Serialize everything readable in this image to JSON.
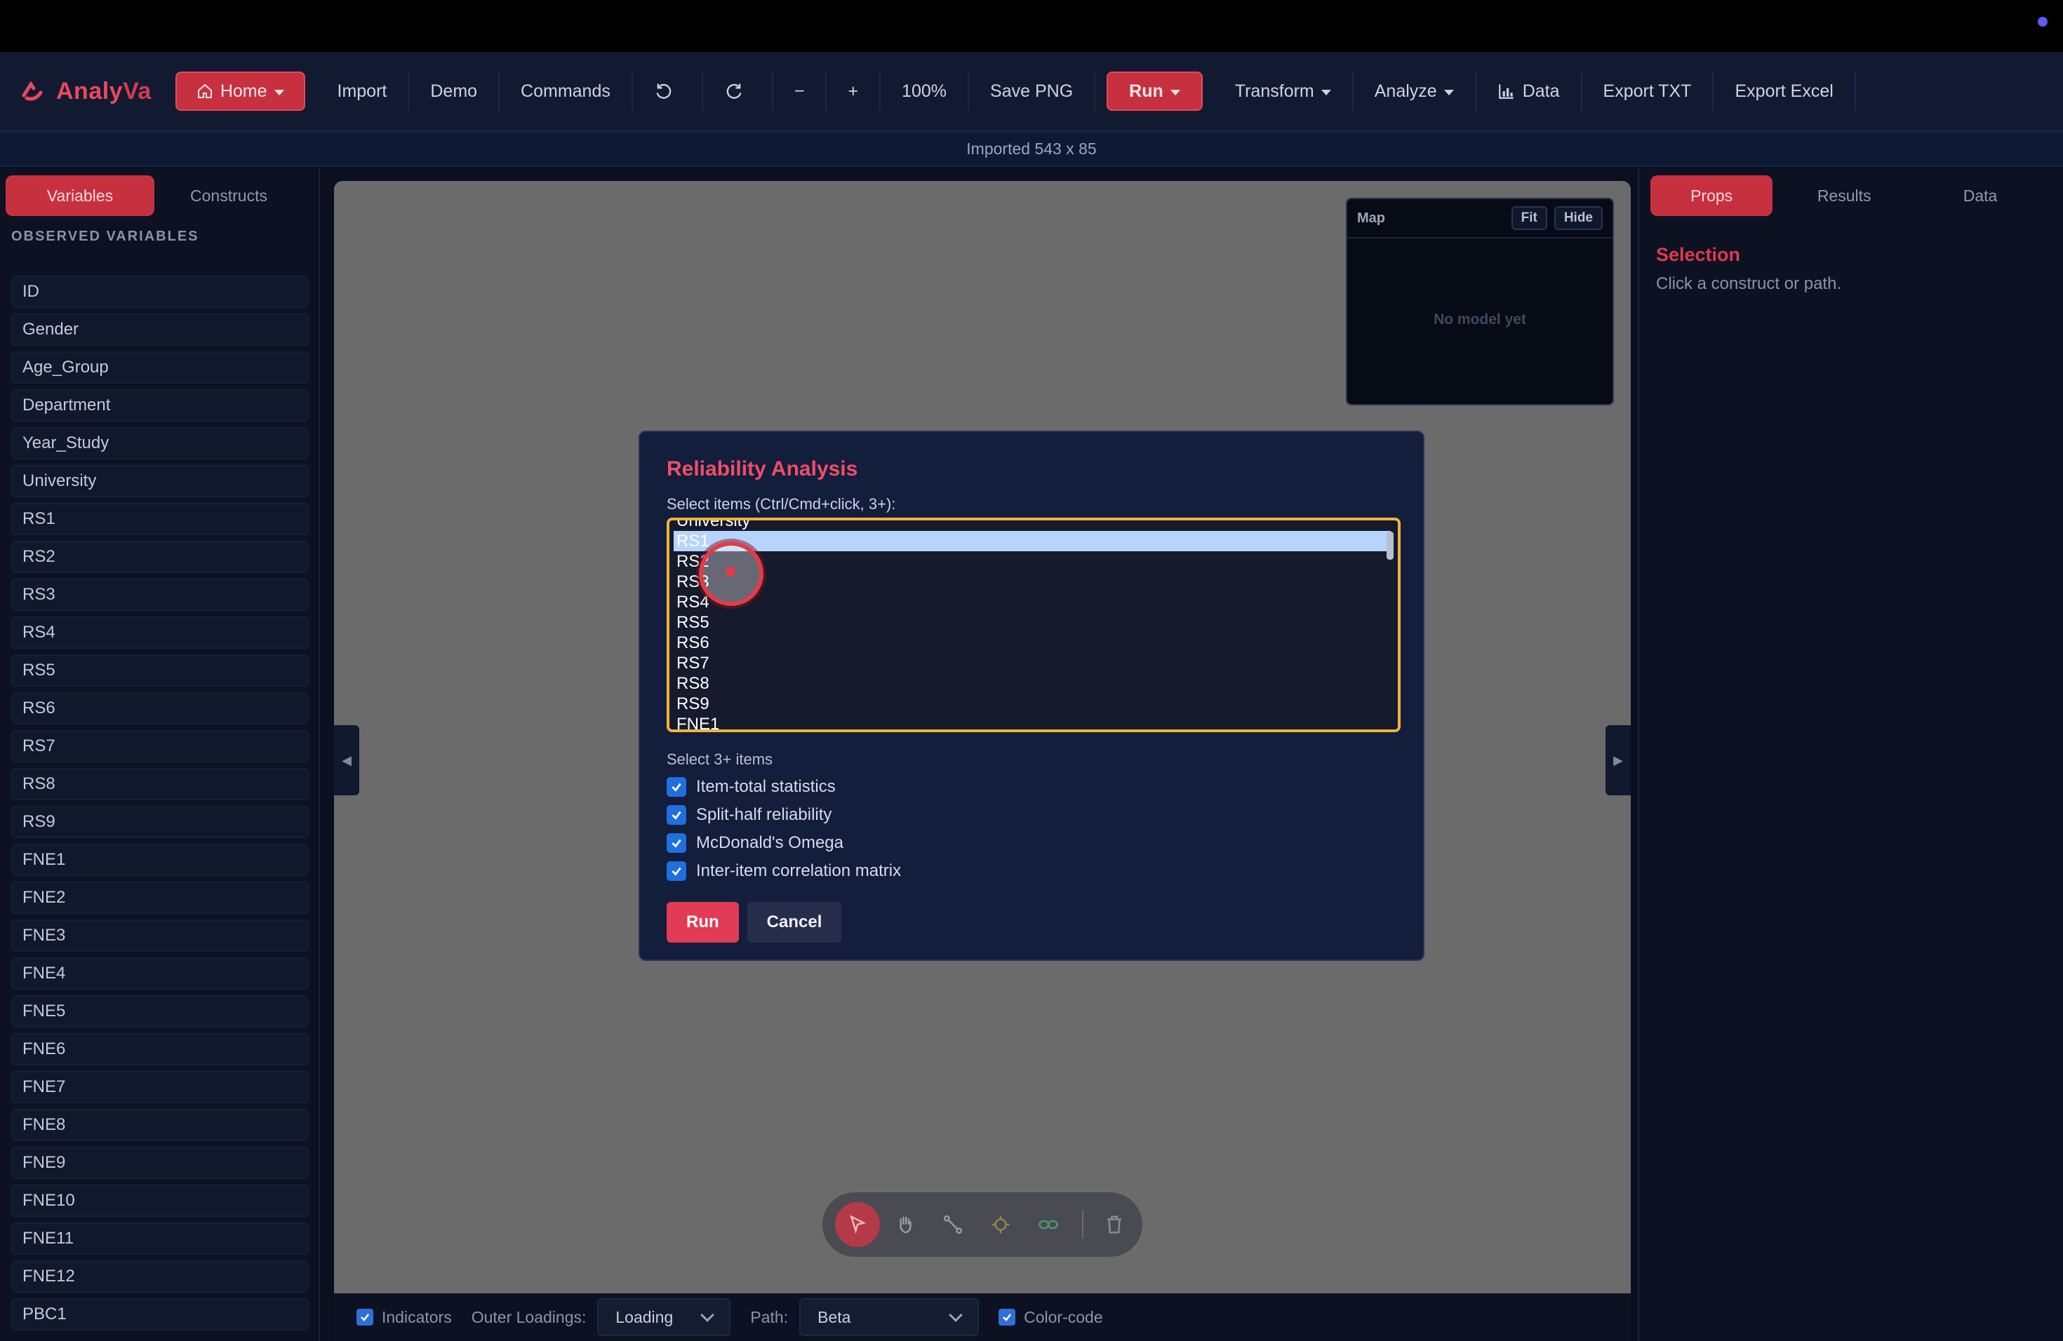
{
  "app": {
    "name_a": "Analy",
    "name_b": "Va"
  },
  "toolbar": {
    "home": "Home",
    "import": "Import",
    "demo": "Demo",
    "commands": "Commands",
    "zoom_out": "−",
    "zoom_in": "+",
    "zoom_level": "100%",
    "save_png": "Save PNG",
    "run": "Run",
    "transform": "Transform",
    "analyze": "Analyze",
    "data": "Data",
    "export_txt": "Export TXT",
    "export_excel": "Export Excel"
  },
  "status": {
    "text": "Imported 543 x 85"
  },
  "left_panel": {
    "tabs": [
      "Variables",
      "Constructs"
    ],
    "section_title": "OBSERVED VARIABLES",
    "variables": [
      "ID",
      "Gender",
      "Age_Group",
      "Department",
      "Year_Study",
      "University",
      "RS1",
      "RS2",
      "RS3",
      "RS4",
      "RS5",
      "RS6",
      "RS7",
      "RS8",
      "RS9",
      "FNE1",
      "FNE2",
      "FNE3",
      "FNE4",
      "FNE5",
      "FNE6",
      "FNE7",
      "FNE8",
      "FNE9",
      "FNE10",
      "FNE11",
      "FNE12",
      "PBC1"
    ]
  },
  "map": {
    "title": "Map",
    "fit": "Fit",
    "hide": "Hide",
    "empty": "No model yet"
  },
  "right_panel": {
    "tabs": [
      "Props",
      "Results",
      "Data"
    ],
    "selection_title": "Selection",
    "selection_desc": "Click a construct or path."
  },
  "bottom_bar": {
    "indicators": "Indicators",
    "outer_loadings_label": "Outer Loadings:",
    "outer_loadings_value": "Loading",
    "path_label": "Path:",
    "path_value": "Beta",
    "color_code": "Color-code"
  },
  "modal": {
    "title": "Reliability Analysis",
    "select_label": "Select items (Ctrl/Cmd+click, 3+):",
    "items": [
      "University",
      "RS1",
      "RS2",
      "RS3",
      "RS4",
      "RS5",
      "RS6",
      "RS7",
      "RS8",
      "RS9",
      "FNE1"
    ],
    "selected_item": "RS1",
    "hint": "Select 3+ items",
    "options": [
      "Item-total statistics",
      "Split-half reliability",
      "McDonald's Omega",
      "Inter-item correlation matrix"
    ],
    "run": "Run",
    "cancel": "Cancel"
  },
  "colors": {
    "accent": "#c7313f",
    "brand": "#e8495f",
    "focus": "#f0b33a"
  }
}
